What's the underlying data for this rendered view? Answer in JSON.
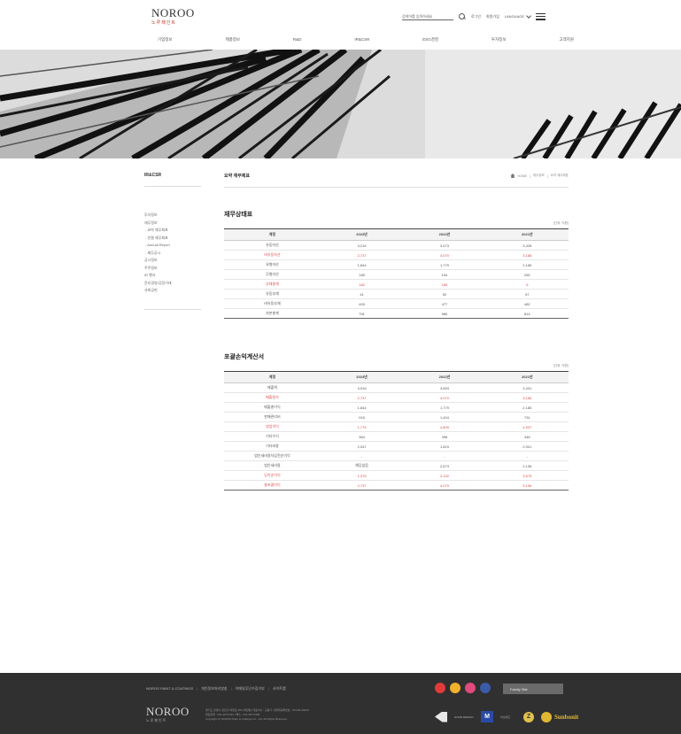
{
  "header": {
    "logo": "NOROO",
    "logo_sub": "노루페인트",
    "search_placeholder": "검색어를 입력하세요",
    "util_links": [
      "로그인",
      "회원가입"
    ],
    "language": "LANGUAGE",
    "nav": [
      "기업정보",
      "제품정보",
      "R&D",
      "IR&CSR",
      "ESG경영",
      "투자정보",
      "고객지원"
    ]
  },
  "sidebar": {
    "title": "IR&CSR",
    "items": [
      "투자정보",
      "재무정보",
      "- 요약 재무제표",
      "- 연결 재무제표",
      "- Annual Report",
      "- 재무공시",
      "공시정보",
      "주주정보",
      "IR 행사",
      "윤리경영/공정거래",
      "사회공헌"
    ]
  },
  "main": {
    "page_title": "요약 재무제표",
    "breadcrumb": [
      "HOME",
      "재무정보",
      "요약 재무제표"
    ],
    "balance": {
      "title": "재무상태표",
      "unit": "(단위: 억원)",
      "headers": [
        "계정",
        "2023년",
        "2022년",
        "2021년"
      ],
      "rows": [
        {
          "label": "유동자산",
          "values": [
            "3,216",
            "3,473",
            "3,428"
          ],
          "highlight": false
        },
        {
          "label": "비유동자산",
          "values": [
            "2,737",
            "4,070",
            "3,188"
          ],
          "highlight": true
        },
        {
          "label": "유형자산",
          "values": [
            "1,844",
            "1,779",
            "2,185"
          ],
          "highlight": false
        },
        {
          "label": "무형자산",
          "values": [
            "185",
            "194",
            "250"
          ],
          "highlight": false
        },
        {
          "label": "부채총계",
          "values": [
            "182",
            "180",
            "6"
          ],
          "highlight": true
        },
        {
          "label": "유동부채",
          "values": [
            "41",
            "52",
            "57"
          ],
          "highlight": false
        },
        {
          "label": "비유동부채",
          "values": [
            "405",
            "477",
            "482"
          ],
          "highlight": false
        },
        {
          "label": "자본총계",
          "values": [
            "751",
            "980",
            "814"
          ],
          "highlight": false
        }
      ]
    },
    "income": {
      "title": "포괄손익계산서",
      "unit": "(단위: 억원)",
      "headers": [
        "계정",
        "2023년",
        "2022년",
        "2021년"
      ],
      "rows": [
        {
          "label": "매출액",
          "values": [
            "3,916",
            "3,893",
            "3,431"
          ],
          "highlight": false
        },
        {
          "label": "매출원가",
          "values": [
            "2,737",
            "4,070",
            "3,156"
          ],
          "highlight": true
        },
        {
          "label": "매출총이익",
          "values": [
            "1,844",
            "1,779",
            "2,185"
          ],
          "highlight": false
        },
        {
          "label": "판매관리비",
          "values": [
            "915",
            "1,404",
            "731"
          ],
          "highlight": false
        },
        {
          "label": "영업이익",
          "values": [
            "1,776",
            "4,809",
            "4,537"
          ],
          "highlight": true
        },
        {
          "label": "기타수익",
          "values": [
            "364",
            "398",
            "348"
          ],
          "highlight": false
        },
        {
          "label": "기타비용",
          "values": [
            "2,047",
            "1,819",
            "2,001"
          ],
          "highlight": false
        },
        {
          "label": "법인세비용차감전순이익",
          "values": [
            "-",
            "-",
            "-"
          ],
          "highlight": false
        },
        {
          "label": "법인세비용",
          "values": [
            "해당없음",
            "2,873",
            "2,136"
          ],
          "highlight": false
        },
        {
          "label": "당기순이익",
          "values": [
            "1,375",
            "2,152",
            "3,575"
          ],
          "highlight": true
        },
        {
          "label": "총포괄이익",
          "values": [
            "2,737",
            "4,070",
            "3,156"
          ],
          "highlight": true
        }
      ]
    }
  },
  "footer": {
    "links": [
      "NOROO PAINT & COATINGS",
      "개인정보처리방침",
      "이메일무단수집거부",
      "사이트맵"
    ],
    "logo": "NOROO",
    "logo_sub": "노루페인트",
    "info": [
      "경기도 안양시 만안구 박달로 351 (박달동) 대표이사 : 김용기 사업자등록번호 : 123-81-04040",
      "대표전화 : 031-467-6114 / 팩스 : 031-467-6399",
      "Copyright (c) NOROO Paint & Coatings Co., Ltd. All Rights Reserved."
    ],
    "family_site": "Family Site",
    "sns_colors": [
      "#e23a3a",
      "#f0b12d",
      "#e04a7f",
      "#3b5ba8"
    ],
    "certs": [
      "GOOD DESIGN",
      "이노비즈",
      "Z",
      "Sunbonit"
    ]
  }
}
